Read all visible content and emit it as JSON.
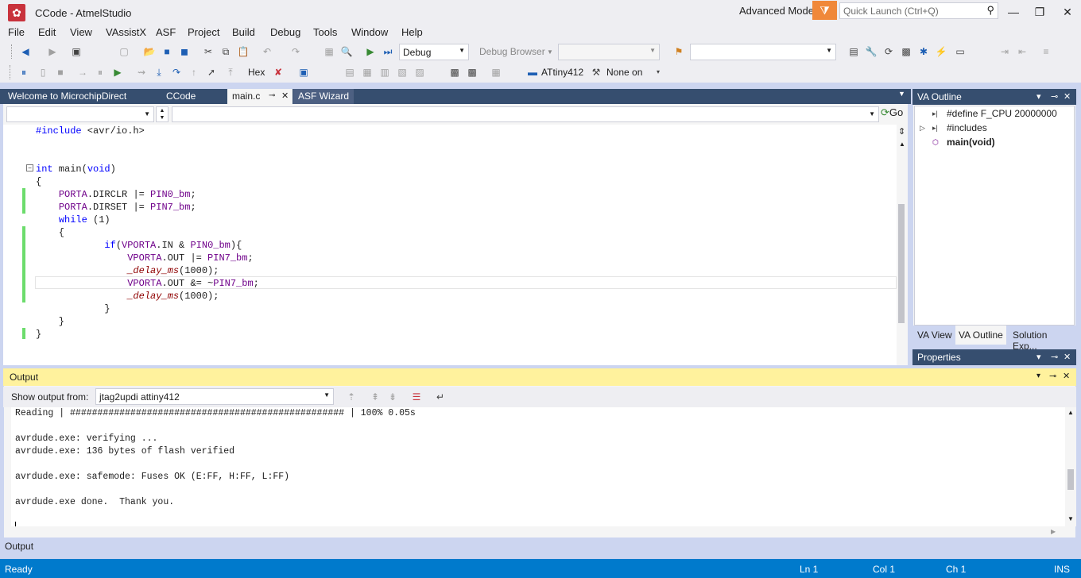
{
  "window": {
    "title": "CCode - AtmelStudio",
    "advanced_mode": "Advanced Mode",
    "quick_launch_placeholder": "Quick Launch (Ctrl+Q)"
  },
  "menu": [
    "File",
    "Edit",
    "View",
    "VAssistX",
    "ASF",
    "Project",
    "Build",
    "Debug",
    "Tools",
    "Window",
    "Help"
  ],
  "toolbar1": {
    "config": "Debug",
    "debug_browser": "Debug Browser",
    "platform": ""
  },
  "toolbar2": {
    "hex_label": "Hex",
    "device": "ATtiny412",
    "tool": "None on"
  },
  "doc_tabs": [
    "Welcome to MicrochipDirect",
    "CCode",
    "main.c",
    "ASF Wizard"
  ],
  "editor_nav": {
    "go": "Go"
  },
  "code_lines": [
    "#include <avr/io.h>",
    "",
    "",
    "int main(void)",
    "{",
    "    PORTA.DIRCLR |= PIN0_bm;",
    "    PORTA.DIRSET |= PIN7_bm;",
    "    while (1)",
    "    {",
    "            if(VPORTA.IN & PIN0_bm){",
    "                VPORTA.OUT |= PIN7_bm;",
    "                _delay_ms(1000);",
    "                VPORTA.OUT &= ~PIN7_bm;",
    "                _delay_ms(1000);",
    "            }",
    "    }",
    "}"
  ],
  "va_outline": {
    "title": "VA Outline",
    "items": [
      "#define F_CPU 20000000",
      "#includes",
      "main(void)"
    ],
    "tabs": [
      "VA View",
      "VA Outline",
      "Solution Exp..."
    ]
  },
  "properties": {
    "title": "Properties"
  },
  "output": {
    "title": "Output",
    "show_from_label": "Show output from:",
    "source": "jtag2updi attiny412",
    "lines": [
      "Reading | ################################################## | 100% 0.05s",
      "",
      "avrdude.exe: verifying ...",
      "avrdude.exe: 136 bytes of flash verified",
      "",
      "avrdude.exe: safemode: Fuses OK (E:FF, H:FF, L:FF)",
      "",
      "avrdude.exe done.  Thank you.",
      "",
      ""
    ],
    "tab_label": "Output"
  },
  "status": {
    "ready": "Ready",
    "ln": "Ln 1",
    "col": "Col 1",
    "ch": "Ch 1",
    "mode": "INS"
  },
  "colors": {
    "accent": "#007acc",
    "panel_header": "#364e6f",
    "output_header": "#fff29d",
    "change_bar": "#6cdc6c"
  }
}
